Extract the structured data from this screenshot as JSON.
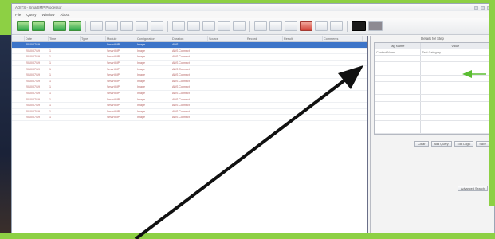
{
  "window": {
    "title": "ADITS - SmartIMP Processor",
    "controls": [
      "minimize",
      "maximize",
      "close"
    ]
  },
  "menu": [
    "File",
    "Query",
    "Window",
    "About"
  ],
  "toolbar": {
    "icons": [
      "back-arrow-icon",
      "forward-arrow-icon",
      "refresh-icon",
      "play-icon",
      "grid-icon",
      "grid-icon",
      "grid-icon",
      "table-icon",
      "table-icon",
      "chart-icon",
      "image-icon",
      "image-icon",
      "camera-icon",
      "folder-icon",
      "document-icon",
      "document-icon",
      "document-icon",
      "filter-icon",
      "stop-icon",
      "filter-icon",
      "settings-icon",
      "monitor-icon",
      "terminal-icon"
    ]
  },
  "list": {
    "headers": [
      "",
      "Date",
      "Time",
      "Type",
      "Module",
      "Configuration",
      "Duration",
      "Source",
      "Record",
      "Result",
      "Comments"
    ],
    "rows": [
      [
        "",
        "2010/07/19",
        "",
        "",
        "SmartIMP",
        "Image",
        "ADS",
        "",
        "",
        "",
        ""
      ],
      [
        "",
        "2010/07/19",
        "1",
        "",
        "SmartIMP",
        "Image",
        "ADS Connect",
        "",
        "",
        "",
        ""
      ],
      [
        "",
        "2010/07/19",
        "1",
        "",
        "SmartIMP",
        "Image",
        "ADS Connect",
        "",
        "",
        "",
        ""
      ],
      [
        "",
        "2010/07/19",
        "1",
        "",
        "SmartIMP",
        "Image",
        "ADS Connect",
        "",
        "",
        "",
        ""
      ],
      [
        "",
        "2010/07/19",
        "1",
        "",
        "SmartIMP",
        "Image",
        "ADS Connect",
        "",
        "",
        "",
        ""
      ],
      [
        "",
        "2010/07/19",
        "1",
        "",
        "SmartIMP",
        "Image",
        "ADS Connect",
        "",
        "",
        "",
        ""
      ],
      [
        "",
        "2010/07/19",
        "1",
        "",
        "SmartIMP",
        "Image",
        "ADS Connect",
        "",
        "",
        "",
        ""
      ],
      [
        "",
        "2010/07/19",
        "1",
        "",
        "SmartIMP",
        "Image",
        "ADS Connect",
        "",
        "",
        "",
        ""
      ],
      [
        "",
        "2010/07/19",
        "1",
        "",
        "SmartIMP",
        "Image",
        "ADS Connect",
        "",
        "",
        "",
        ""
      ],
      [
        "",
        "2010/07/19",
        "1",
        "",
        "SmartIMP",
        "Image",
        "ADS Connect",
        "",
        "",
        "",
        ""
      ],
      [
        "",
        "2010/07/19",
        "1",
        "",
        "SmartIMP",
        "Image",
        "ADS Connect",
        "",
        "",
        "",
        ""
      ],
      [
        "",
        "2010/07/19",
        "1",
        "",
        "SmartIMP",
        "Image",
        "ADS Connect",
        "",
        "",
        "",
        ""
      ],
      [
        "",
        "2010/07/19",
        "1",
        "",
        "SmartIMP",
        "Image",
        "ADS Connect",
        "",
        "",
        "",
        ""
      ]
    ]
  },
  "details": {
    "title": "Details for Step",
    "col_name": "Tag Name",
    "col_value": "Value",
    "rows": [
      [
        "Context Name",
        "Test Category"
      ],
      [
        "",
        ""
      ],
      [
        "",
        ""
      ],
      [
        "",
        ""
      ],
      [
        "",
        ""
      ],
      [
        "",
        ""
      ],
      [
        "",
        ""
      ],
      [
        "",
        ""
      ],
      [
        "",
        ""
      ],
      [
        "",
        ""
      ],
      [
        "",
        ""
      ],
      [
        "",
        ""
      ],
      [
        "",
        ""
      ]
    ],
    "buttons": [
      "Clear",
      "Add Query",
      "Edit Logic",
      "Save"
    ],
    "advanced_button": "Advanced Search"
  },
  "colors": {
    "frame_green": "#8dd044",
    "selection_blue": "#3c74c8",
    "row_text": "#b25c5c",
    "arrow_black": "#111111",
    "arrow_green": "#5bbd32"
  }
}
